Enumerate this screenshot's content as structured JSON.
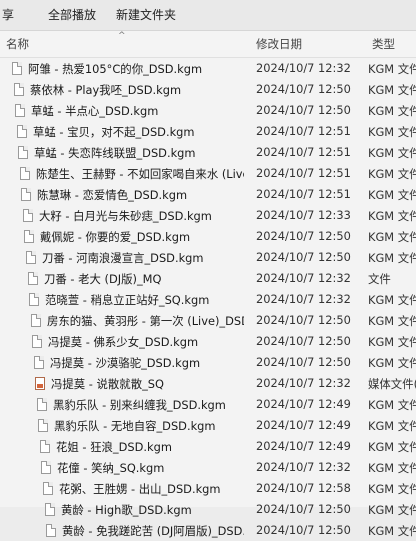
{
  "toolbar": {
    "partial_label": "享",
    "play_all_label": "全部播放",
    "new_folder_label": "新建文件夹"
  },
  "header": {
    "name": "名称",
    "date": "修改日期",
    "type": "类型"
  },
  "files": [
    {
      "name": "阿雏 - 热爱105°C的你_DSD.kgm",
      "date": "2024/10/7 12:32",
      "type": "KGM 文件",
      "icon": "document-icon"
    },
    {
      "name": "蔡依林 - Play我呸_DSD.kgm",
      "date": "2024/10/7 12:50",
      "type": "KGM 文件",
      "icon": "document-icon"
    },
    {
      "name": "草蜢 - 半点心_DSD.kgm",
      "date": "2024/10/7 12:50",
      "type": "KGM 文件",
      "icon": "document-icon"
    },
    {
      "name": "草蜢 - 宝贝，对不起_DSD.kgm",
      "date": "2024/10/7 12:51",
      "type": "KGM 文件",
      "icon": "document-icon"
    },
    {
      "name": "草蜢 - 失恋阵线联盟_DSD.kgm",
      "date": "2024/10/7 12:51",
      "type": "KGM 文件",
      "icon": "document-icon"
    },
    {
      "name": "陈楚生、王赫野 - 不如回家喝自来水 (Live)",
      "date": "2024/10/7 12:51",
      "type": "KGM 文件",
      "icon": "document-icon"
    },
    {
      "name": "陈慧琳 - 恋爱情色_DSD.kgm",
      "date": "2024/10/7 12:51",
      "type": "KGM 文件",
      "icon": "document-icon"
    },
    {
      "name": "大籽 - 白月光与朱砂痣_DSD.kgm",
      "date": "2024/10/7 12:33",
      "type": "KGM 文件",
      "icon": "document-icon"
    },
    {
      "name": "戴佩妮 - 你要的爱_DSD.kgm",
      "date": "2024/10/7 12:50",
      "type": "KGM 文件",
      "icon": "document-icon"
    },
    {
      "name": "刀番 - 河南浪漫宣言_DSD.kgm",
      "date": "2024/10/7 12:50",
      "type": "KGM 文件",
      "icon": "document-icon"
    },
    {
      "name": "刀番 - 老大 (DJ版)_MQ",
      "date": "2024/10/7 12:32",
      "type": "文件",
      "icon": "document-icon"
    },
    {
      "name": "范晓萱 - 稍息立正站好_SQ.kgm",
      "date": "2024/10/7 12:32",
      "type": "KGM 文件",
      "icon": "document-icon"
    },
    {
      "name": "房东的猫、黄羽彤 - 第一次 (Live)_DSD....",
      "date": "2024/10/7 12:50",
      "type": "KGM 文件",
      "icon": "document-icon"
    },
    {
      "name": "冯提莫 - 佛系少女_DSD.kgm",
      "date": "2024/10/7 12:50",
      "type": "KGM 文件",
      "icon": "document-icon"
    },
    {
      "name": "冯提莫 - 沙漠骆驼_DSD.kgm",
      "date": "2024/10/7 12:50",
      "type": "KGM 文件",
      "icon": "document-icon"
    },
    {
      "name": "冯提莫 - 说散就散_SQ",
      "date": "2024/10/7 12:32",
      "type": "媒体文件(.f",
      "icon": "media-file-icon"
    },
    {
      "name": "黑豹乐队 - 别来纠缠我_DSD.kgm",
      "date": "2024/10/7 12:49",
      "type": "KGM 文件",
      "icon": "document-icon"
    },
    {
      "name": "黑豹乐队 - 无地自容_DSD.kgm",
      "date": "2024/10/7 12:49",
      "type": "KGM 文件",
      "icon": "document-icon"
    },
    {
      "name": "花姐 - 狂浪_DSD.kgm",
      "date": "2024/10/7 12:49",
      "type": "KGM 文件",
      "icon": "document-icon"
    },
    {
      "name": "花僮 - 笑纳_SQ.kgm",
      "date": "2024/10/7 12:32",
      "type": "KGM 文件",
      "icon": "document-icon"
    },
    {
      "name": "花粥、王胜娚 - 出山_DSD.kgm",
      "date": "2024/10/7 12:58",
      "type": "KGM 文件",
      "icon": "document-icon"
    },
    {
      "name": "黄龄 - High歌_DSD.kgm",
      "date": "2024/10/7 12:50",
      "type": "KGM 文件",
      "icon": "document-icon"
    },
    {
      "name": "黄龄 - 免我蹉跎苦 (DJ阿眉版)_DSD.kgm",
      "date": "2024/10/7 12:50",
      "type": "KGM 文件",
      "icon": "document-icon"
    }
  ]
}
